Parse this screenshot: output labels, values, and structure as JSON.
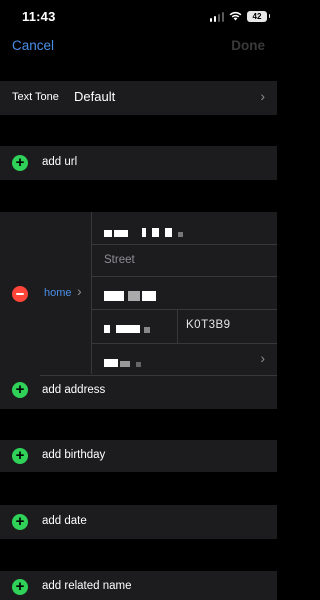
{
  "status_bar": {
    "time": "11:43",
    "battery": "42"
  },
  "nav": {
    "cancel_label": "Cancel",
    "done_label": "Done"
  },
  "text_tone": {
    "label": "Text Tone",
    "value": "Default"
  },
  "add_url": {
    "label": "add url"
  },
  "address": {
    "type_label": "home",
    "street_placeholder": "Street",
    "postal_partial": "K0T3B9"
  },
  "add_address": {
    "label": "add address"
  },
  "add_birthday": {
    "label": "add birthday"
  },
  "add_date": {
    "label": "add date"
  },
  "add_related_name": {
    "label": "add related name"
  }
}
